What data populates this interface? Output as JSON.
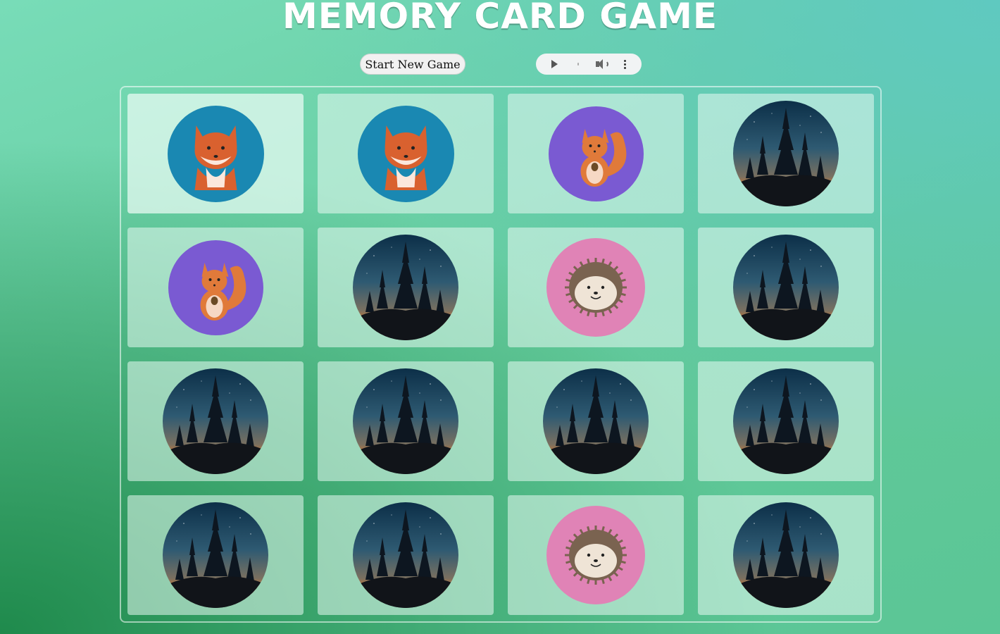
{
  "header": {
    "title": "MEMORY CARD GAME"
  },
  "controls": {
    "start_label": "Start New Game"
  },
  "board": {
    "rows": 4,
    "cols": 4,
    "cards": [
      {
        "face": "fox",
        "color": "#1a88b2"
      },
      {
        "face": "fox",
        "color": "#1a88b2"
      },
      {
        "face": "squirrel",
        "color": "#7a5ad2"
      },
      {
        "face": "back"
      },
      {
        "face": "squirrel",
        "color": "#7a5ad2"
      },
      {
        "face": "back"
      },
      {
        "face": "hedgehog",
        "color": "#e083b6"
      },
      {
        "face": "back"
      },
      {
        "face": "back"
      },
      {
        "face": "back"
      },
      {
        "face": "back"
      },
      {
        "face": "back"
      },
      {
        "face": "back"
      },
      {
        "face": "back"
      },
      {
        "face": "hedgehog",
        "color": "#e083b6"
      },
      {
        "face": "back"
      }
    ]
  },
  "colors": {
    "card_back_sky_top": "#0c2f48",
    "card_back_sky_mid": "#2e5a72",
    "card_back_horizon": "#d9782a",
    "fox_fur": "#d9612f",
    "squirrel_fur": "#e07a3a",
    "hedgehog_spines": "#7a6350"
  }
}
